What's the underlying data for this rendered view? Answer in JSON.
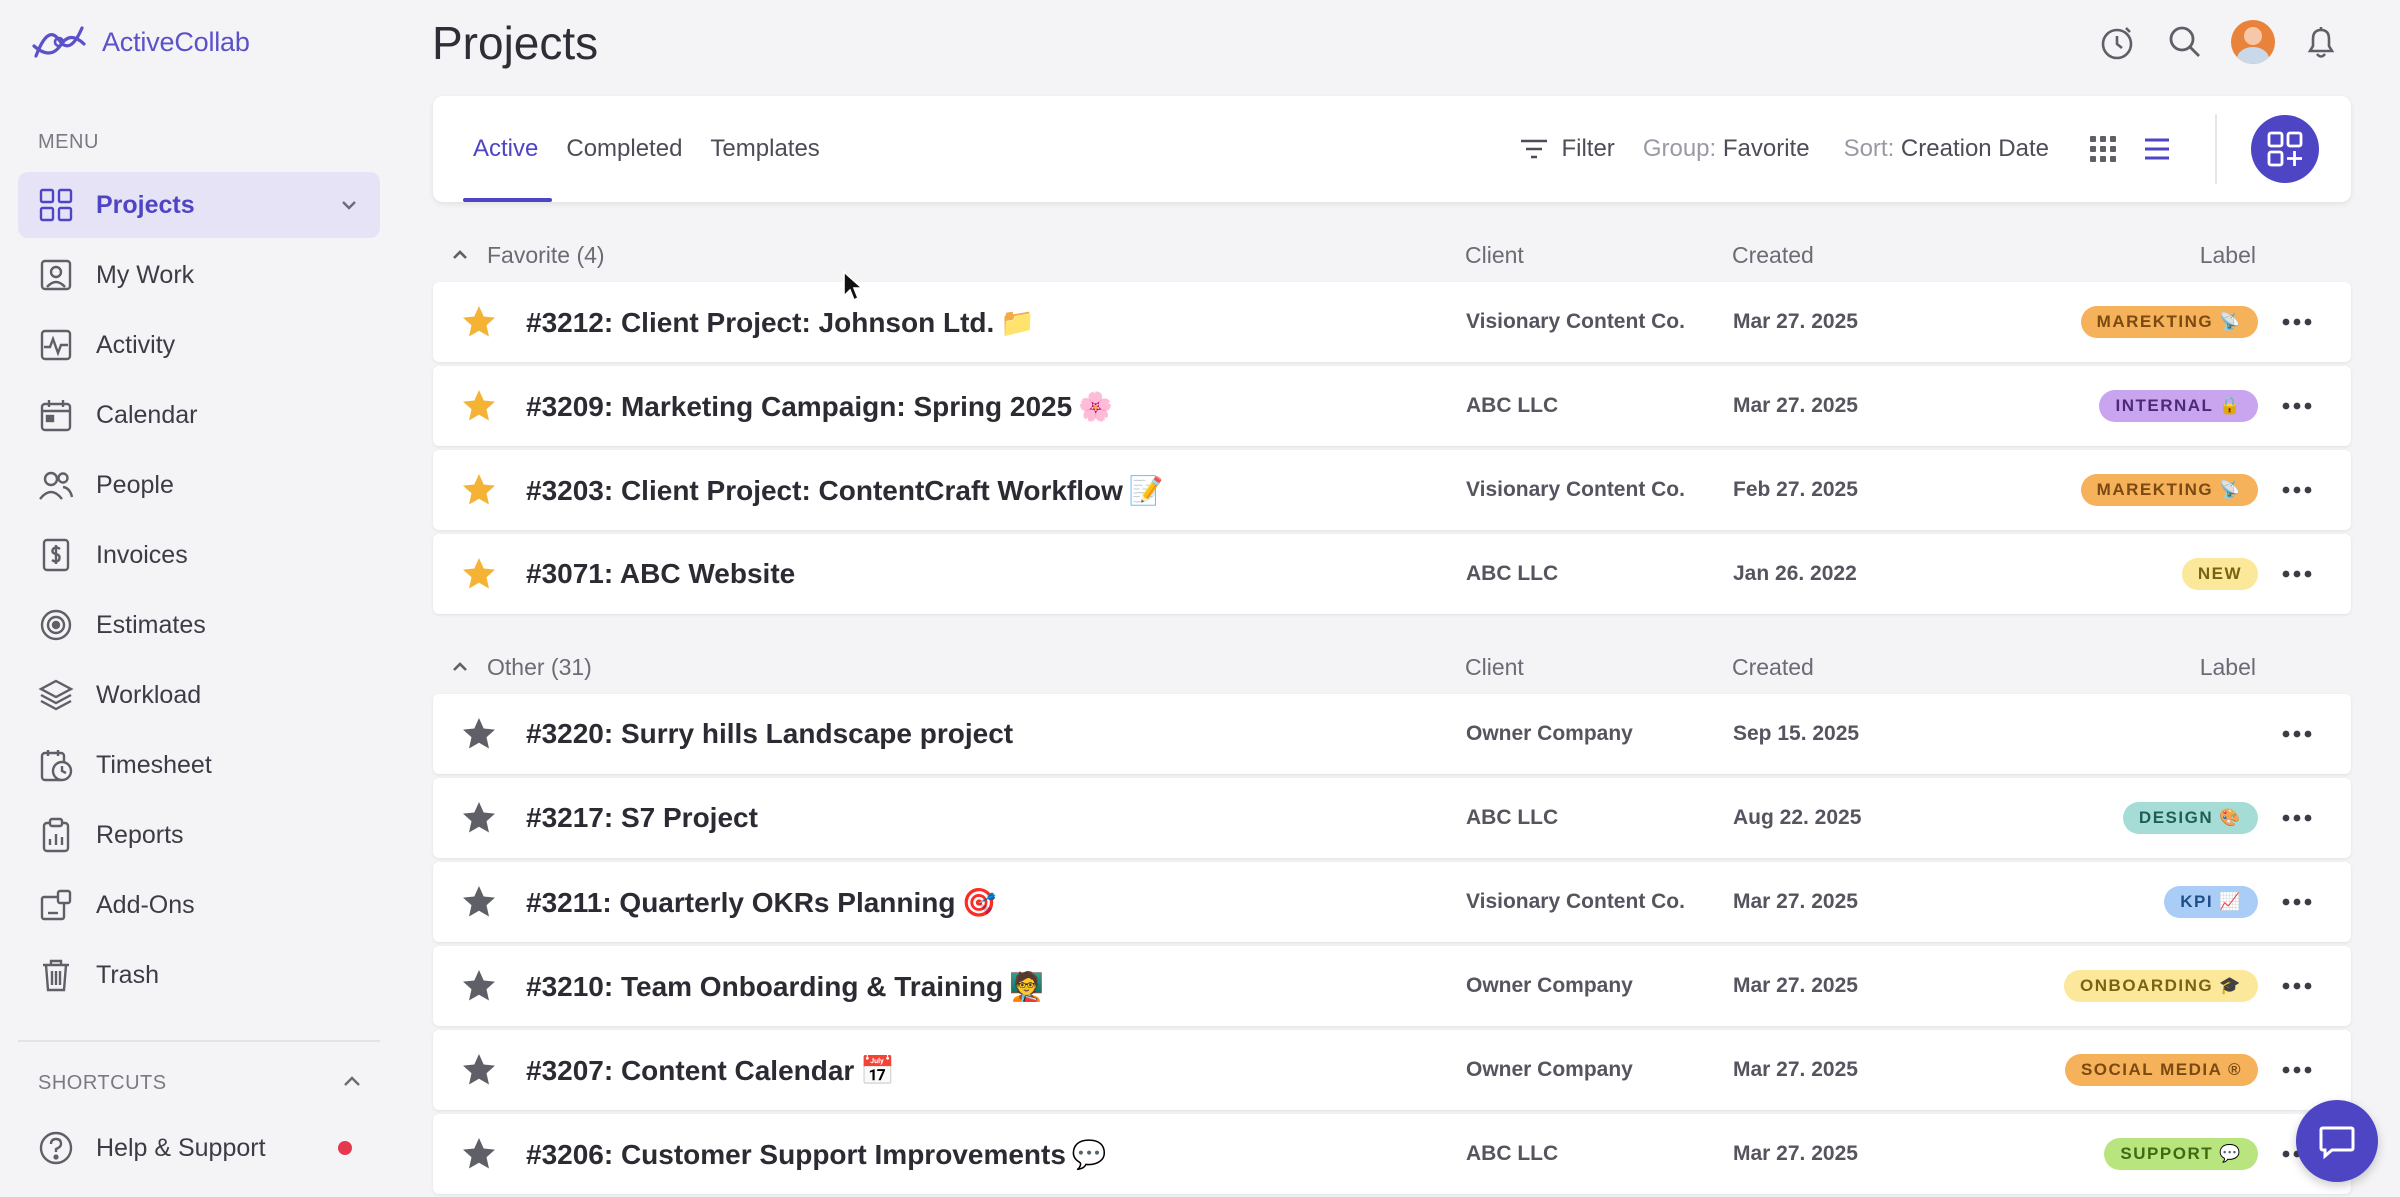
{
  "app": {
    "name": "ActiveCollab"
  },
  "sidebar": {
    "menu_caption": "MENU",
    "items": [
      {
        "label": "Projects",
        "icon": "grid-icon",
        "active": true
      },
      {
        "label": "My Work",
        "icon": "person-card-icon"
      },
      {
        "label": "Activity",
        "icon": "activity-icon"
      },
      {
        "label": "Calendar",
        "icon": "calendar-icon"
      },
      {
        "label": "People",
        "icon": "people-icon"
      },
      {
        "label": "Invoices",
        "icon": "invoice-dollar-icon"
      },
      {
        "label": "Estimates",
        "icon": "target-icon"
      },
      {
        "label": "Workload",
        "icon": "layers-icon"
      },
      {
        "label": "Timesheet",
        "icon": "timesheet-clock-icon"
      },
      {
        "label": "Reports",
        "icon": "reports-icon"
      },
      {
        "label": "Add-Ons",
        "icon": "addons-icon"
      },
      {
        "label": "Trash",
        "icon": "trash-icon"
      }
    ],
    "shortcuts_caption": "SHORTCUTS",
    "help_label": "Help & Support"
  },
  "header": {
    "title": "Projects"
  },
  "toolbar": {
    "tabs": [
      {
        "label": "Active"
      },
      {
        "label": "Completed"
      },
      {
        "label": "Templates"
      }
    ],
    "filter_label": "Filter",
    "group_key": "Group:",
    "group_value": "Favorite",
    "sort_key": "Sort:",
    "sort_value": "Creation Date"
  },
  "columns": {
    "client": "Client",
    "created": "Created",
    "label": "Label"
  },
  "groups": [
    {
      "title": "Favorite (4)",
      "projects": [
        {
          "name": "#3212: Client Project: Johnson Ltd.",
          "emoji": "📁",
          "client": "Visionary Content Co.",
          "created": "Mar 27. 2025",
          "label": "MAREKTING 📡",
          "label_bg": "#f6b15b",
          "label_fg": "#7a4a12",
          "starred": true
        },
        {
          "name": "#3209: Marketing Campaign: Spring 2025",
          "emoji": "🌸",
          "client": "ABC LLC",
          "created": "Mar 27. 2025",
          "label": "INTERNAL 🔒",
          "label_bg": "#c9a4ef",
          "label_fg": "#4c2a7a",
          "starred": true
        },
        {
          "name": "#3203: Client Project: ContentCraft Workflow",
          "emoji": "📝",
          "client": "Visionary Content Co.",
          "created": "Feb 27. 2025",
          "label": "MAREKTING 📡",
          "label_bg": "#f6b15b",
          "label_fg": "#7a4a12",
          "starred": true
        },
        {
          "name": "#3071: ABC Website",
          "emoji": "",
          "client": "ABC LLC",
          "created": "Jan 26. 2022",
          "label": "NEW",
          "label_bg": "#fbe89a",
          "label_fg": "#7a6310",
          "starred": true
        }
      ]
    },
    {
      "title": "Other (31)",
      "projects": [
        {
          "name": "#3220: Surry hills Landscape project",
          "emoji": "",
          "client": "Owner Company",
          "created": "Sep 15. 2025",
          "label": "",
          "starred": false
        },
        {
          "name": "#3217: S7 Project",
          "emoji": "",
          "client": "ABC LLC",
          "created": "Aug 22. 2025",
          "label": "DESIGN 🎨",
          "label_bg": "#a5ddd6",
          "label_fg": "#1f5e57",
          "starred": false
        },
        {
          "name": "#3211: Quarterly OKRs Planning",
          "emoji": "🎯",
          "client": "Visionary Content Co.",
          "created": "Mar 27. 2025",
          "label": "KPI 📈",
          "label_bg": "#a9cdf6",
          "label_fg": "#1f4f87",
          "starred": false
        },
        {
          "name": "#3210: Team Onboarding & Training",
          "emoji": "🧑‍🏫",
          "client": "Owner Company",
          "created": "Mar 27. 2025",
          "label": "ONBOARDING 🎓",
          "label_bg": "#fbe89a",
          "label_fg": "#7a6310",
          "starred": false
        },
        {
          "name": "#3207: Content Calendar",
          "emoji": "📅",
          "client": "Owner Company",
          "created": "Mar 27. 2025",
          "label": "SOCIAL MEDIA ®",
          "label_bg": "#f6b15b",
          "label_fg": "#7a4a12",
          "starred": false
        },
        {
          "name": "#3206: Customer Support Improvements",
          "emoji": "💬",
          "client": "ABC LLC",
          "created": "Mar 27. 2025",
          "label": "SUPPORT 💬",
          "label_bg": "#b9e57f",
          "label_fg": "#3d6a12",
          "starred": false
        }
      ]
    }
  ],
  "colors": {
    "accent": "#4e45c4",
    "star_active": "#f5b335",
    "star_inactive": "#5f5f68"
  }
}
